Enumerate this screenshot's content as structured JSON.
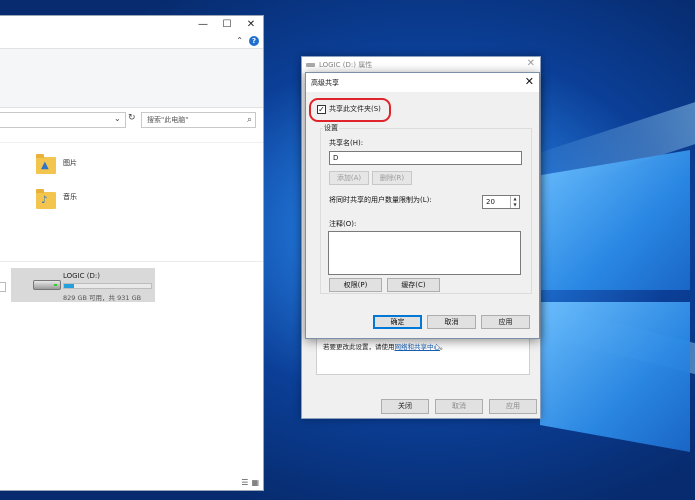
{
  "explorer": {
    "window_controls": {
      "minimize": "—",
      "maximize": "☐",
      "close": "✕"
    },
    "ribbon_expand": "⌃",
    "help": "?",
    "address_dropdown": "⌄",
    "refresh": "↻",
    "search_placeholder": "搜索\"此电脑\"",
    "folders": [
      {
        "name": "图片",
        "icon": "pictures-folder-icon",
        "glyph": "▲"
      },
      {
        "name": "音乐",
        "icon": "music-folder-icon",
        "glyph": "♪"
      }
    ],
    "drive": {
      "name": "LOGIC (D:)",
      "free_text": "829 GB 可用，共 931 GB",
      "used_fraction": 0.11
    },
    "view_icons": {
      "details": "☰",
      "tiles": "▦"
    }
  },
  "properties_dialog": {
    "title": "LOGIC (D:) 属性",
    "close": "✕",
    "hint_prefix": "若要更改此设置，请使用",
    "hint_link": "网络和共享中心",
    "hint_suffix": "。",
    "buttons": {
      "close": "关闭",
      "cancel": "取消",
      "apply": "应用"
    }
  },
  "advanced_sharing": {
    "title": "高级共享",
    "close": "✕",
    "share_checkbox": {
      "label": "共享此文件夹(S)",
      "checked": true,
      "mark": "✓"
    },
    "settings_group": "设置",
    "share_name_label": "共享名(H):",
    "share_name_value": "D",
    "add_button": "添加(A)",
    "remove_button": "删除(R)",
    "user_limit_label": "将同时共享的用户数量限制为(L):",
    "user_limit_value": "20",
    "spin_up": "▲",
    "spin_down": "▼",
    "comment_label": "注释(O):",
    "comment_value": "",
    "permissions_button": "权限(P)",
    "caching_button": "缓存(C)",
    "ok_button": "确定",
    "cancel_button": "取消",
    "apply_button": "应用"
  },
  "colors": {
    "highlight_ring": "#e0242b",
    "link": "#1a5fb4",
    "drive_bar": "#26a0da",
    "desktop": "#1f6fd0"
  }
}
